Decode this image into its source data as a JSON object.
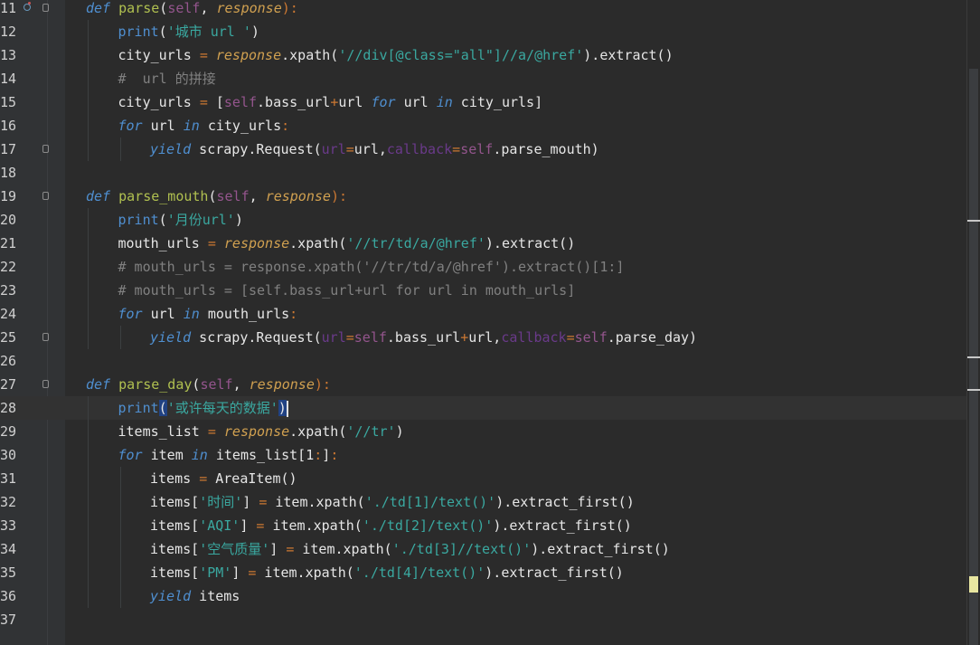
{
  "editor": {
    "lines": [
      {
        "n": "11",
        "tokens": [
          [
            "kw",
            "def"
          ],
          [
            "id",
            " "
          ],
          [
            "fn",
            "parse"
          ],
          [
            "id",
            "("
          ],
          [
            "self",
            "self"
          ],
          [
            "id",
            ", "
          ],
          [
            "param",
            "response"
          ],
          [
            "op",
            ")"
          ],
          [
            "op",
            ":"
          ]
        ],
        "indent": 0,
        "fold": true,
        "bp": true
      },
      {
        "n": "12",
        "tokens": [
          [
            "kw2",
            "print"
          ],
          [
            "id",
            "("
          ],
          [
            "str",
            "'城市 url '"
          ],
          [
            "id",
            ")"
          ]
        ],
        "indent": 1
      },
      {
        "n": "13",
        "tokens": [
          [
            "id",
            "city_urls "
          ],
          [
            "op",
            "="
          ],
          [
            "id",
            " "
          ],
          [
            "param",
            "response"
          ],
          [
            "id",
            ".xpath("
          ],
          [
            "str",
            "'//div[@class=\"all\"]//a/@href'"
          ],
          [
            "id",
            ").extract()"
          ]
        ],
        "indent": 1
      },
      {
        "n": "14",
        "tokens": [
          [
            "cm",
            "#  url 的拼接"
          ]
        ],
        "indent": 1
      },
      {
        "n": "15",
        "tokens": [
          [
            "id",
            "city_urls "
          ],
          [
            "op",
            "="
          ],
          [
            "id",
            " ["
          ],
          [
            "self",
            "self"
          ],
          [
            "id",
            ".bass_url"
          ],
          [
            "op",
            "+"
          ],
          [
            "id",
            "url "
          ],
          [
            "kw",
            "for"
          ],
          [
            "id",
            " url "
          ],
          [
            "kw",
            "in"
          ],
          [
            "id",
            " city_urls]"
          ]
        ],
        "indent": 1
      },
      {
        "n": "16",
        "tokens": [
          [
            "kw",
            "for"
          ],
          [
            "id",
            " url "
          ],
          [
            "kw",
            "in"
          ],
          [
            "id",
            " city_urls"
          ],
          [
            "op",
            ":"
          ]
        ],
        "indent": 1
      },
      {
        "n": "17",
        "tokens": [
          [
            "kw",
            "yield"
          ],
          [
            "id",
            " scrapy.Request("
          ],
          [
            "kwarg",
            "url"
          ],
          [
            "op",
            "="
          ],
          [
            "id",
            "url,"
          ],
          [
            "kwarg",
            "callback"
          ],
          [
            "op",
            "="
          ],
          [
            "self",
            "self"
          ],
          [
            "id",
            ".parse_mouth)"
          ]
        ],
        "indent": 2,
        "fold": true
      },
      {
        "n": "18",
        "tokens": [],
        "indent": 0
      },
      {
        "n": "19",
        "tokens": [
          [
            "kw",
            "def"
          ],
          [
            "id",
            " "
          ],
          [
            "fn",
            "parse_mouth"
          ],
          [
            "id",
            "("
          ],
          [
            "self",
            "self"
          ],
          [
            "id",
            ", "
          ],
          [
            "param",
            "response"
          ],
          [
            "op",
            ")"
          ],
          [
            "op",
            ":"
          ]
        ],
        "indent": 0,
        "fold": true
      },
      {
        "n": "20",
        "tokens": [
          [
            "kw2",
            "print"
          ],
          [
            "id",
            "("
          ],
          [
            "str",
            "'月份url'"
          ],
          [
            "id",
            ")"
          ]
        ],
        "indent": 1
      },
      {
        "n": "21",
        "tokens": [
          [
            "id",
            "mouth_urls "
          ],
          [
            "op",
            "="
          ],
          [
            "id",
            " "
          ],
          [
            "param",
            "response"
          ],
          [
            "id",
            ".xpath("
          ],
          [
            "str",
            "'//tr/td/a/@href'"
          ],
          [
            "id",
            ").extract()"
          ]
        ],
        "indent": 1
      },
      {
        "n": "22",
        "tokens": [
          [
            "cm",
            "# mouth_urls = response.xpath('//tr/td/a/@href').extract()[1:]"
          ]
        ],
        "indent": 1
      },
      {
        "n": "23",
        "tokens": [
          [
            "cm",
            "# mouth_urls = [self.bass_url+url for url in mouth_urls]"
          ]
        ],
        "indent": 1
      },
      {
        "n": "24",
        "tokens": [
          [
            "kw",
            "for"
          ],
          [
            "id",
            " url "
          ],
          [
            "kw",
            "in"
          ],
          [
            "id",
            " mouth_urls"
          ],
          [
            "op",
            ":"
          ]
        ],
        "indent": 1
      },
      {
        "n": "25",
        "tokens": [
          [
            "kw",
            "yield"
          ],
          [
            "id",
            " scrapy.Request("
          ],
          [
            "kwarg",
            "url"
          ],
          [
            "op",
            "="
          ],
          [
            "self",
            "self"
          ],
          [
            "id",
            ".bass_url"
          ],
          [
            "op",
            "+"
          ],
          [
            "id",
            "url,"
          ],
          [
            "kwarg",
            "callback"
          ],
          [
            "op",
            "="
          ],
          [
            "self",
            "self"
          ],
          [
            "id",
            ".parse_day)"
          ]
        ],
        "indent": 2,
        "fold": true
      },
      {
        "n": "26",
        "tokens": [],
        "indent": 0
      },
      {
        "n": "27",
        "tokens": [
          [
            "kw",
            "def"
          ],
          [
            "id",
            " "
          ],
          [
            "fn",
            "parse_day"
          ],
          [
            "id",
            "("
          ],
          [
            "self",
            "self"
          ],
          [
            "id",
            ", "
          ],
          [
            "param",
            "response"
          ],
          [
            "op",
            ")"
          ],
          [
            "op",
            ":"
          ]
        ],
        "indent": 0,
        "fold": true
      },
      {
        "n": "28",
        "tokens": [
          [
            "kw2",
            "print"
          ],
          [
            "sel",
            "("
          ],
          [
            "str",
            "'或许每天的数据'"
          ],
          [
            "sel",
            ")"
          ]
        ],
        "indent": 1,
        "current": true
      },
      {
        "n": "29",
        "tokens": [
          [
            "id",
            "items_list "
          ],
          [
            "op",
            "="
          ],
          [
            "id",
            " "
          ],
          [
            "param",
            "response"
          ],
          [
            "id",
            ".xpath("
          ],
          [
            "str",
            "'//tr'"
          ],
          [
            "id",
            ")"
          ]
        ],
        "indent": 1
      },
      {
        "n": "30",
        "tokens": [
          [
            "kw",
            "for"
          ],
          [
            "id",
            " item "
          ],
          [
            "kw",
            "in"
          ],
          [
            "id",
            " items_list[1"
          ],
          [
            "op",
            ":"
          ],
          [
            "id",
            "]"
          ],
          [
            "op",
            ":"
          ]
        ],
        "indent": 1
      },
      {
        "n": "31",
        "tokens": [
          [
            "id",
            "items "
          ],
          [
            "op",
            "="
          ],
          [
            "id",
            " AreaItem()"
          ]
        ],
        "indent": 2
      },
      {
        "n": "32",
        "tokens": [
          [
            "id",
            "items["
          ],
          [
            "str",
            "'时间'"
          ],
          [
            "id",
            "] "
          ],
          [
            "op",
            "="
          ],
          [
            "id",
            " item.xpath("
          ],
          [
            "str",
            "'./td[1]/text()'"
          ],
          [
            "id",
            ").extract_first()"
          ]
        ],
        "indent": 2
      },
      {
        "n": "33",
        "tokens": [
          [
            "id",
            "items["
          ],
          [
            "str",
            "'AQI'"
          ],
          [
            "id",
            "] "
          ],
          [
            "op",
            "="
          ],
          [
            "id",
            " item.xpath("
          ],
          [
            "str",
            "'./td[2]/text()'"
          ],
          [
            "id",
            ").extract_first()"
          ]
        ],
        "indent": 2
      },
      {
        "n": "34",
        "tokens": [
          [
            "id",
            "items["
          ],
          [
            "str",
            "'空气质量'"
          ],
          [
            "id",
            "] "
          ],
          [
            "op",
            "="
          ],
          [
            "id",
            " item.xpath("
          ],
          [
            "str",
            "'./td[3]//text()'"
          ],
          [
            "id",
            ").extract_first()"
          ]
        ],
        "indent": 2
      },
      {
        "n": "35",
        "tokens": [
          [
            "id",
            "items["
          ],
          [
            "str",
            "'PM'"
          ],
          [
            "id",
            "] "
          ],
          [
            "op",
            "="
          ],
          [
            "id",
            " item.xpath("
          ],
          [
            "str",
            "'./td[4]/text()'"
          ],
          [
            "id",
            ").extract_first()"
          ]
        ],
        "indent": 2
      },
      {
        "n": "36",
        "tokens": [
          [
            "kw",
            "yield"
          ],
          [
            "id",
            " items"
          ]
        ],
        "indent": 2
      },
      {
        "n": "37",
        "tokens": [],
        "indent": 0
      }
    ]
  },
  "colors": {
    "background": "#2b2b2b",
    "gutter": "#313335",
    "keyword": "#4f8fd0",
    "function": "#b0c050",
    "self": "#94558d",
    "param": "#d0a050",
    "string": "#3aa8a0",
    "comment": "#808080"
  },
  "icons": {
    "fold": "fold-marker-icon",
    "breakpoint": "override-marker-icon"
  }
}
